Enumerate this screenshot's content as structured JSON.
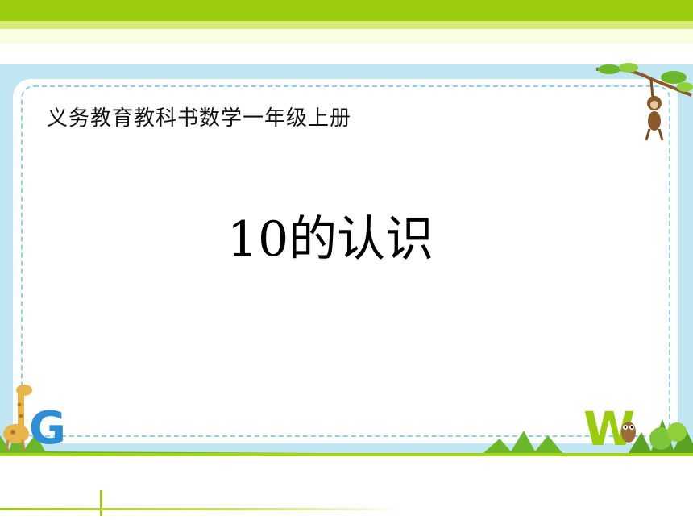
{
  "slide": {
    "subtitle": "义务教育教科书数学一年级上册",
    "title": "10的认识"
  },
  "decor": {
    "top_band_color": "#9acb0c",
    "frame_color": "#bfe6f1",
    "dash_color": "#8fd0e3",
    "grass_color": "#6ab82a",
    "icons": [
      "monkey-icon",
      "giraffe-icon",
      "letter-g-icon",
      "letter-w-icon",
      "owl-icon",
      "grass-icon"
    ]
  }
}
